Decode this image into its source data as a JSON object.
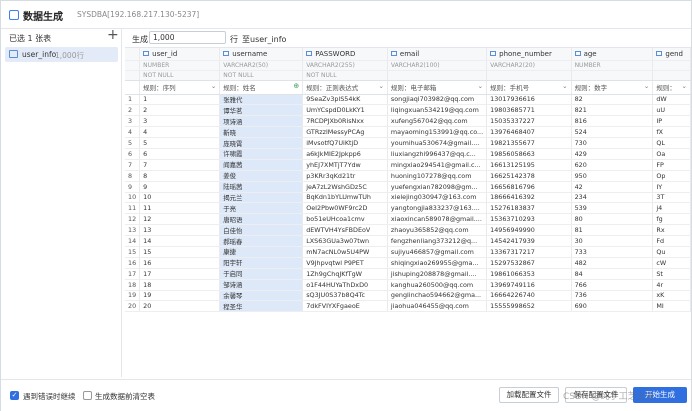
{
  "window": {
    "title": "数据生成",
    "subtitle": "SYSDBA[192.168.217.130-5237]"
  },
  "sidebar": {
    "header": "已选 1 张表",
    "add": "+",
    "items": [
      {
        "name": "user_info",
        "count": "1,000行"
      }
    ]
  },
  "gen": {
    "label": "生成",
    "value": "1,000",
    "mid": "行",
    "table": "至user_info"
  },
  "columns": [
    {
      "name": "",
      "type": "",
      "nn": "",
      "rule": "",
      "w": 14
    },
    {
      "name": "user_id",
      "type": "NUMBER",
      "nn": "NOT NULL",
      "rule": "规则：序列",
      "w": 84
    },
    {
      "name": "username",
      "type": "VARCHAR2(50)",
      "nn": "NOT NULL",
      "rule": "规则：姓名",
      "w": 86,
      "sel": true
    },
    {
      "name": "PASSWORD",
      "type": "VARCHAR2(255)",
      "nn": "NOT NULL",
      "rule": "规则：正则表达式",
      "w": 86
    },
    {
      "name": "email",
      "type": "VARCHAR2(100)",
      "nn": "",
      "rule": "规则：电子邮箱",
      "w": 86
    },
    {
      "name": "phone_number",
      "type": "VARCHAR2(20)",
      "nn": "",
      "rule": "规则：手机号",
      "w": 86
    },
    {
      "name": "age",
      "type": "NUMBER",
      "nn": "",
      "rule": "规则：数字",
      "w": 86
    },
    {
      "name": "gend",
      "type": "",
      "nn": "",
      "rule": "规则：",
      "w": 38
    }
  ],
  "rows": [
    [
      "1",
      "1",
      "张雅代",
      "9SeaZv3plS54kK",
      "songjiaqi703982@qq.com",
      "13017936616",
      "82",
      "dW"
    ],
    [
      "2",
      "2",
      "谭华茗",
      "UmYCspdD0LkKY1",
      "liqingxuan534219@qq.com",
      "19803685771",
      "821",
      "uU"
    ],
    [
      "3",
      "3",
      "项诗涵",
      "7RCDPJXb0RisNxx",
      "xufeng567042@qq.com",
      "15035337227",
      "816",
      "IP"
    ],
    [
      "4",
      "4",
      "靳晓",
      "GTRzzlMessyPCAg",
      "mayaoming153991@qq.co...",
      "13976468407",
      "524",
      "fX"
    ],
    [
      "5",
      "5",
      "庞晓霄",
      "iMvsotfQ7UiKtjD",
      "youmihua530674@gmail....",
      "19821355677",
      "730",
      "QL"
    ],
    [
      "6",
      "6",
      "许啸霞",
      "a6kJkMIE2Jpkpp6",
      "liuxiangzhi996437@qq.c...",
      "19856058663",
      "429",
      "Oa"
    ],
    [
      "7",
      "7",
      "阎嘉茜",
      "yhEJ7XMTjT7Ydw",
      "mingxiao294541@gmail.c...",
      "16613125195",
      "620",
      "FP"
    ],
    [
      "8",
      "8",
      "姜俊",
      "p3KRr3qKd21tr",
      "huoning107278@qq.com",
      "16625142378",
      "950",
      "Op"
    ],
    [
      "9",
      "9",
      "陆瑶茜",
      "jeA7zL2WshGDz5C",
      "yuefengxian782098@gm...",
      "16656816796",
      "42",
      "IY"
    ],
    [
      "10",
      "10",
      "揭元兰",
      "BqKdn1bYLUmwTUh",
      "xielejing030947@163.com",
      "18666416392",
      "234",
      "3T"
    ],
    [
      "11",
      "11",
      "于亮",
      "OeI2Pbw0WF9rc2D",
      "yangtongjia833237@163....",
      "15276183837",
      "539",
      "j4"
    ],
    [
      "12",
      "12",
      "唐昭语",
      "bo51eUHcoa1cmv",
      "xiaoxincan589078@gmail....",
      "15363710293",
      "80",
      "fg"
    ],
    [
      "13",
      "13",
      "白佳怡",
      "dEWTVH4YsFBDEoV",
      "zhaoyu365852@qq.com",
      "14956949990",
      "81",
      "Rx"
    ],
    [
      "14",
      "14",
      "郝瑶春",
      "LXS63GUa3w07twn",
      "fengzhenliang373212@q...",
      "14542417939",
      "30",
      "Fd"
    ],
    [
      "15",
      "15",
      "康捷",
      "mN7acNL0w5U4PW",
      "sujiyu466857@gmail.com",
      "13367317217",
      "733",
      "Qu"
    ],
    [
      "16",
      "16",
      "阳宇轩",
      "V9Jhpvqtwl P9PET",
      "shiqingxiao269955@gma...",
      "15297532867",
      "482",
      "cW"
    ],
    [
      "17",
      "17",
      "于启同",
      "1Zh9gChqJKfTgW",
      "jishuping208878@gmail....",
      "19861066353",
      "84",
      "St"
    ],
    [
      "18",
      "18",
      "邹诗涵",
      "o1F44HUYaThDxD0",
      "kanghua260500@qq.com",
      "13969749116",
      "766",
      "4r"
    ],
    [
      "19",
      "19",
      "余馨琴",
      "sQ3JU0S37b8Q4Tc",
      "genglinchao594662@gma...",
      "16664226740",
      "736",
      "xK"
    ],
    [
      "20",
      "20",
      "程圣华",
      "7dkFVIYXFgaeoE",
      "jiaohua046455@qq.com",
      "15555998652",
      "690",
      "MI"
    ]
  ],
  "footer": {
    "cb1": "遇到错误时继续",
    "cb2": "生成数据前清空表",
    "btn_config": "加载配置文件",
    "btn_save": "保存配置文件",
    "btn_gen": "开始生成"
  },
  "watermark": "CSDN @纯手工芝士朱"
}
